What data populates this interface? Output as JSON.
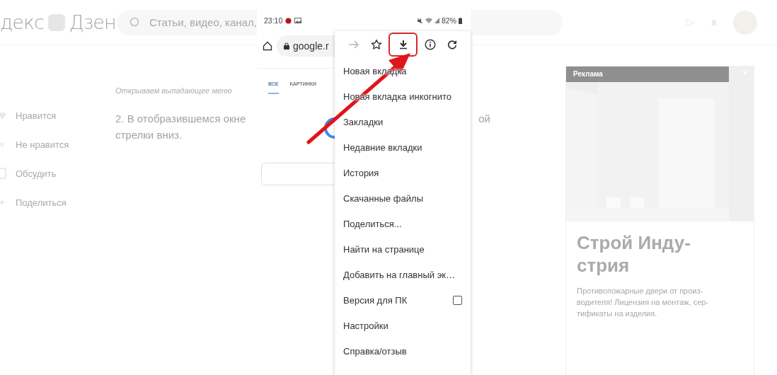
{
  "site_header": {
    "logo_left": "декс",
    "logo_right": "Дзен",
    "search": {
      "placeholder": "Статьи, видео, канал,"
    }
  },
  "actions": [
    {
      "kind": "like",
      "label": "Нравится"
    },
    {
      "kind": "dislike",
      "label": "Не нравится"
    },
    {
      "kind": "comment",
      "label": "Обсудить"
    },
    {
      "kind": "share",
      "label": "Поделиться"
    }
  ],
  "article": {
    "caption": "Открываем выпадающее меню",
    "line1_start": "2. В отобразившемся окне",
    "line1_end": "ой",
    "line2": "стрелки вниз."
  },
  "ad": {
    "badge": "Реклама",
    "title_lines": [
      "Строй Инду-",
      "стрия"
    ],
    "text_lines": [
      "Противопожарные двери от произ-",
      "водителя! Лицензия на монтаж, сер-",
      "тификаты на изделия."
    ]
  },
  "phone": {
    "time": "23:10",
    "battery": "82%",
    "url": "google.r",
    "tabs": [
      {
        "label": "ВСЕ",
        "selected": true
      },
      {
        "label": "КАРТИНКИ",
        "selected": false
      }
    ],
    "toolbar": [
      {
        "kind": "forward",
        "disabled": true,
        "highlighted": false
      },
      {
        "kind": "star",
        "disabled": false,
        "highlighted": false
      },
      {
        "kind": "download",
        "disabled": false,
        "highlighted": true
      },
      {
        "kind": "info",
        "disabled": false,
        "highlighted": false
      },
      {
        "kind": "refresh",
        "disabled": false,
        "highlighted": false
      }
    ],
    "menu": [
      {
        "kind": "text",
        "label": "Новая вкладка"
      },
      {
        "kind": "text",
        "label": "Новая вкладка инкогнито"
      },
      {
        "kind": "text",
        "label": "Закладки"
      },
      {
        "kind": "text",
        "label": "Недавние вкладки"
      },
      {
        "kind": "text",
        "label": "История"
      },
      {
        "kind": "text",
        "label": "Скачанные файлы"
      },
      {
        "kind": "text",
        "label": "Поделиться..."
      },
      {
        "kind": "text",
        "label": "Найти на странице"
      },
      {
        "kind": "text",
        "label": "Добавить на главный эк…"
      },
      {
        "kind": "checkbox",
        "label": "Версия для ПК",
        "checked": false
      },
      {
        "kind": "text",
        "label": "Настройки"
      },
      {
        "kind": "text",
        "label": "Справка/отзыв"
      }
    ]
  }
}
